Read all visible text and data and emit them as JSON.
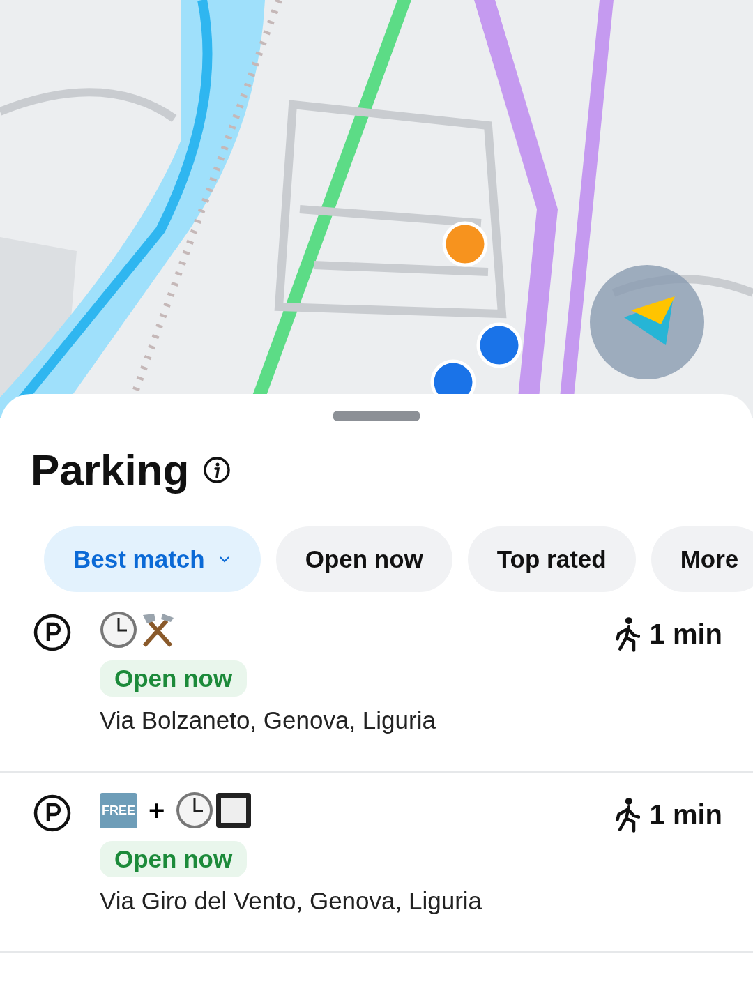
{
  "sheet": {
    "title": "Parking"
  },
  "filters": [
    {
      "label": "Best match",
      "selected": true,
      "dropdown": true
    },
    {
      "label": "Open now",
      "selected": false,
      "dropdown": false
    },
    {
      "label": "Top rated",
      "selected": false,
      "dropdown": false
    },
    {
      "label": "More",
      "selected": false,
      "dropdown": false
    }
  ],
  "results": [
    {
      "symbols": [
        {
          "kind": "clock"
        },
        {
          "kind": "tools"
        }
      ],
      "status": "Open now",
      "address": "Via Bolzaneto, Genova, Liguria",
      "walk": "1 min"
    },
    {
      "symbols": [
        {
          "kind": "free",
          "text": "FREE"
        },
        {
          "kind": "plus",
          "text": "+"
        },
        {
          "kind": "clock"
        },
        {
          "kind": "square"
        }
      ],
      "status": "Open now",
      "address": "Via Giro del Vento, Genova, Liguria",
      "walk": "1 min"
    }
  ]
}
